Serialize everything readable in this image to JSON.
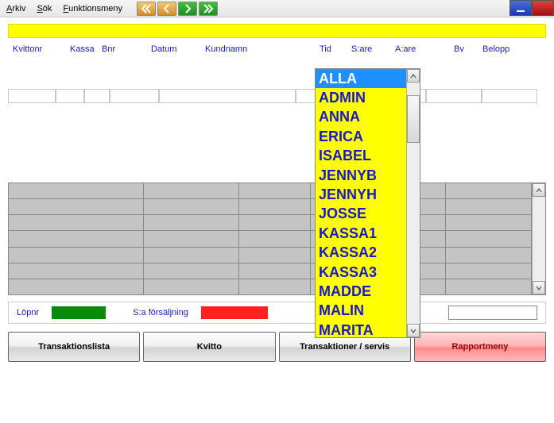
{
  "menu": {
    "arkiv": "Arkiv",
    "sok": "Sök",
    "funk": "Funktionsmeny"
  },
  "columns": {
    "kvittonr": "Kvittonr",
    "kassa": "Kassa",
    "bnr": "Bnr",
    "datum": "Datum",
    "kundnamn": "Kundnamn",
    "tid": "Tid",
    "sare": "S:are",
    "aare": "A:are",
    "bv": "Bv",
    "belopp": "Belopp"
  },
  "status": {
    "lopnr": "Löpnr",
    "sa_fors": "S:a försäljning"
  },
  "buttons": {
    "translist": "Transaktionslista",
    "kvitto": "Kvitto",
    "transserv": "Transaktioner / servis",
    "rapport": "Rapportmeny"
  },
  "dropdown": {
    "items": [
      "ALLA",
      "ADMIN",
      "ANNA",
      "ERICA",
      "ISABEL",
      "JENNYB",
      "JENNYH",
      "JOSSE",
      "KASSA1",
      "KASSA2",
      "KASSA3",
      "MADDE",
      "MALIN",
      "MARITA"
    ],
    "selected_index": 0
  }
}
